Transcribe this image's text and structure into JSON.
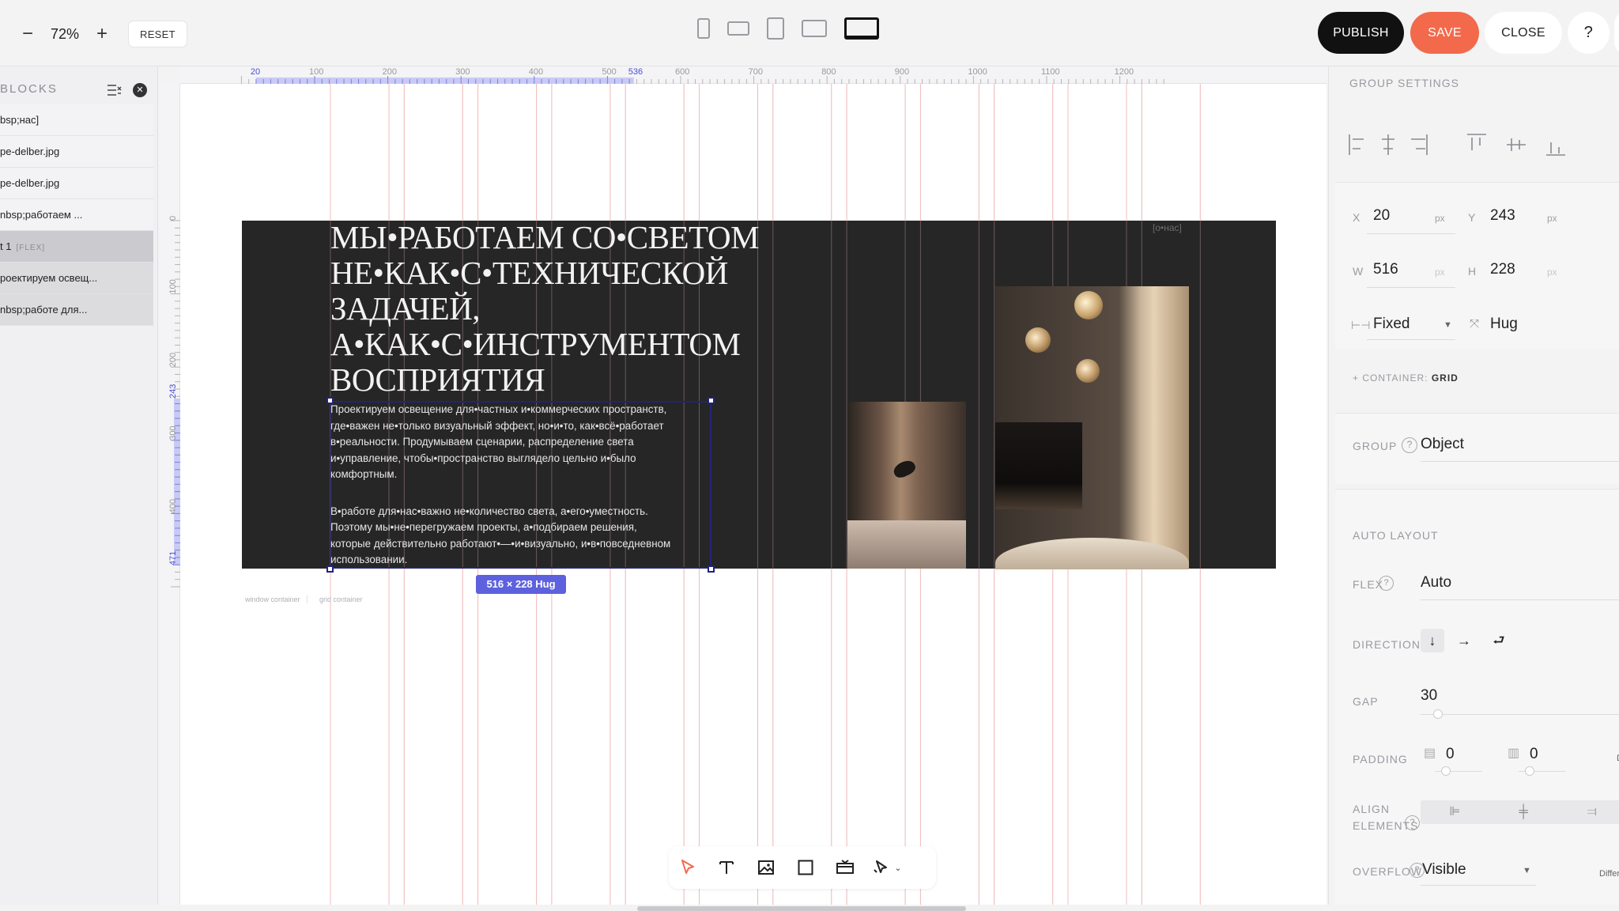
{
  "topbar": {
    "zoom_minus": "−",
    "zoom_value": "72%",
    "zoom_plus": "+",
    "reset_label": "RESET",
    "publish_label": "PUBLISH",
    "save_label": "SAVE",
    "close_label": "CLOSE",
    "help_label": "?",
    "devices": [
      "mobile-portrait",
      "mobile-landscape",
      "tablet-portrait",
      "tablet-landscape",
      "desktop"
    ],
    "active_device": "desktop"
  },
  "colors": {
    "accent": "#f26a4b",
    "selection": "#4b4fd0",
    "banner_bg": "#262626",
    "guide": "#f0b6b6"
  },
  "left_panel": {
    "title": "BLOCKS",
    "layers": [
      {
        "label": "bsp;нас]",
        "tag": "",
        "state": "normal"
      },
      {
        "label": "pe-delber.jpg",
        "tag": "",
        "state": "normal"
      },
      {
        "label": "pe-delber.jpg",
        "tag": "",
        "state": "normal"
      },
      {
        "label": "nbsp;работаем ...",
        "tag": "",
        "state": "normal"
      },
      {
        "label": "t 1",
        "tag": "[FLEX]",
        "state": "selected"
      },
      {
        "label": "роектируем освещ...",
        "tag": "",
        "state": "sub"
      },
      {
        "label": "nbsp;работе для...",
        "tag": "",
        "state": "sub"
      }
    ]
  },
  "ruler": {
    "h_labels": [
      "20",
      "100",
      "200",
      "300",
      "400",
      "500",
      "536",
      "600",
      "700",
      "800",
      "900",
      "1000",
      "1100",
      "1200"
    ],
    "v_labels": [
      "0",
      "100",
      "200",
      "243",
      "300",
      "400",
      "471"
    ]
  },
  "canvas": {
    "heading": [
      "МЫ•РАБОТАЕМ СО•СВЕТОМ",
      "НЕ•КАК•С•ТЕХНИЧЕСКОЙ ЗАДАЧЕЙ,",
      "А•КАК•С•ИНСТРУМЕНТОМ",
      "ВОСПРИЯТИЯ"
    ],
    "corner_tag": "[о•нас]",
    "paragraph1": [
      "Проектируем освещение для•частных и•коммерческих пространств,",
      "где•важен не•только визуальный эффект, но•и•то, как•всё•работает",
      "в•реальности. Продумываем сценарии, распределение света",
      "и•управление, чтобы•пространство выглядело цельно и•было",
      "комфортным."
    ],
    "paragraph2": [
      "В•работе для•нас•важно не•количество света, а•его•уместность.",
      "Поэтому мы•не•перегружаем проекты, а•подбираем решения,",
      "которые действительно работают•—•и•визуально, и•в•повседневном",
      "использовании."
    ],
    "size_badge": "516 × 228 Hug",
    "label_window": "window container",
    "label_grid": "grid container"
  },
  "right_panel": {
    "title": "GROUP SETTINGS",
    "x_label": "X",
    "x_value": "20",
    "x_unit": "px",
    "y_label": "Y",
    "y_value": "243",
    "y_unit": "px",
    "w_label": "W",
    "w_value": "516",
    "w_unit": "px",
    "h_label": "H",
    "h_value": "228",
    "h_unit": "px",
    "width_mode": "Fixed",
    "height_mode": "Hug",
    "container_prefix": "+ CONTAINER:",
    "container_value": "GRID",
    "group_label": "GROUP",
    "group_value": "Object",
    "auto_layout_label": "AUTO LAYOUT",
    "flex_label": "FLEX",
    "flex_value": "Auto",
    "direction_label": "DIRECTION",
    "gap_label": "GAP",
    "gap_value": "30",
    "padding_label": "PADDING",
    "padding_v": "0",
    "padding_h": "0",
    "padding_more": "Di",
    "align_label_1": "ALIGN",
    "align_label_2": "ELEMENTS",
    "overflow_label": "OVERFLOW",
    "overflow_value": "Visible",
    "overflow_extra": "Differ"
  },
  "bottom_toolbar": {
    "tools": [
      "pointer-icon",
      "text-icon",
      "image-icon",
      "shape-icon",
      "block-icon",
      "interaction-icon"
    ]
  }
}
